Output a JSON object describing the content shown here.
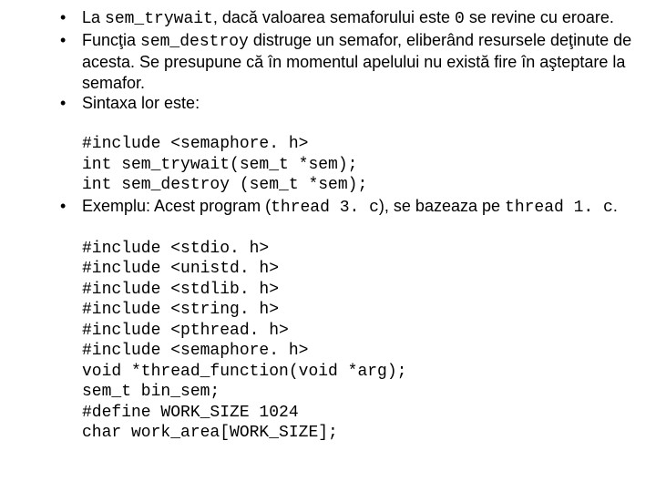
{
  "bullets": {
    "b1": {
      "t1": "La ",
      "code1": "sem_trywait",
      "t2": ", dacă valoarea semaforului este ",
      "code2": "0",
      "t3": " se revine cu eroare."
    },
    "b2": {
      "t1": "Funcţia ",
      "code1": "sem_destroy",
      "t2": " distruge un semafor, eliberând resursele deţinute de acesta. Se presupune că în momentul apelului nu există fire în aşteptare la semafor."
    },
    "b3": {
      "t1": "Sintaxa lor este:",
      "code_lines": [
        "#include <semaphore. h>",
        "int sem_trywait(sem_t *sem);",
        "int sem_destroy (sem_t *sem);"
      ]
    },
    "b4": {
      "t1": "Exemplu: Acest program (",
      "code1": "thread 3. c",
      "t2": "), se bazeaza pe ",
      "code2": "thread 1. c",
      "t3": ".",
      "code_lines": [
        "#include <stdio. h>",
        "#include <unistd. h>",
        "#include <stdlib. h>",
        "#include <string. h>",
        "#include <pthread. h>",
        "#include <semaphore. h>",
        "void *thread_function(void *arg);",
        "sem_t bin_sem;",
        "#define WORK_SIZE 1024",
        "char work_area[WORK_SIZE];"
      ]
    }
  }
}
